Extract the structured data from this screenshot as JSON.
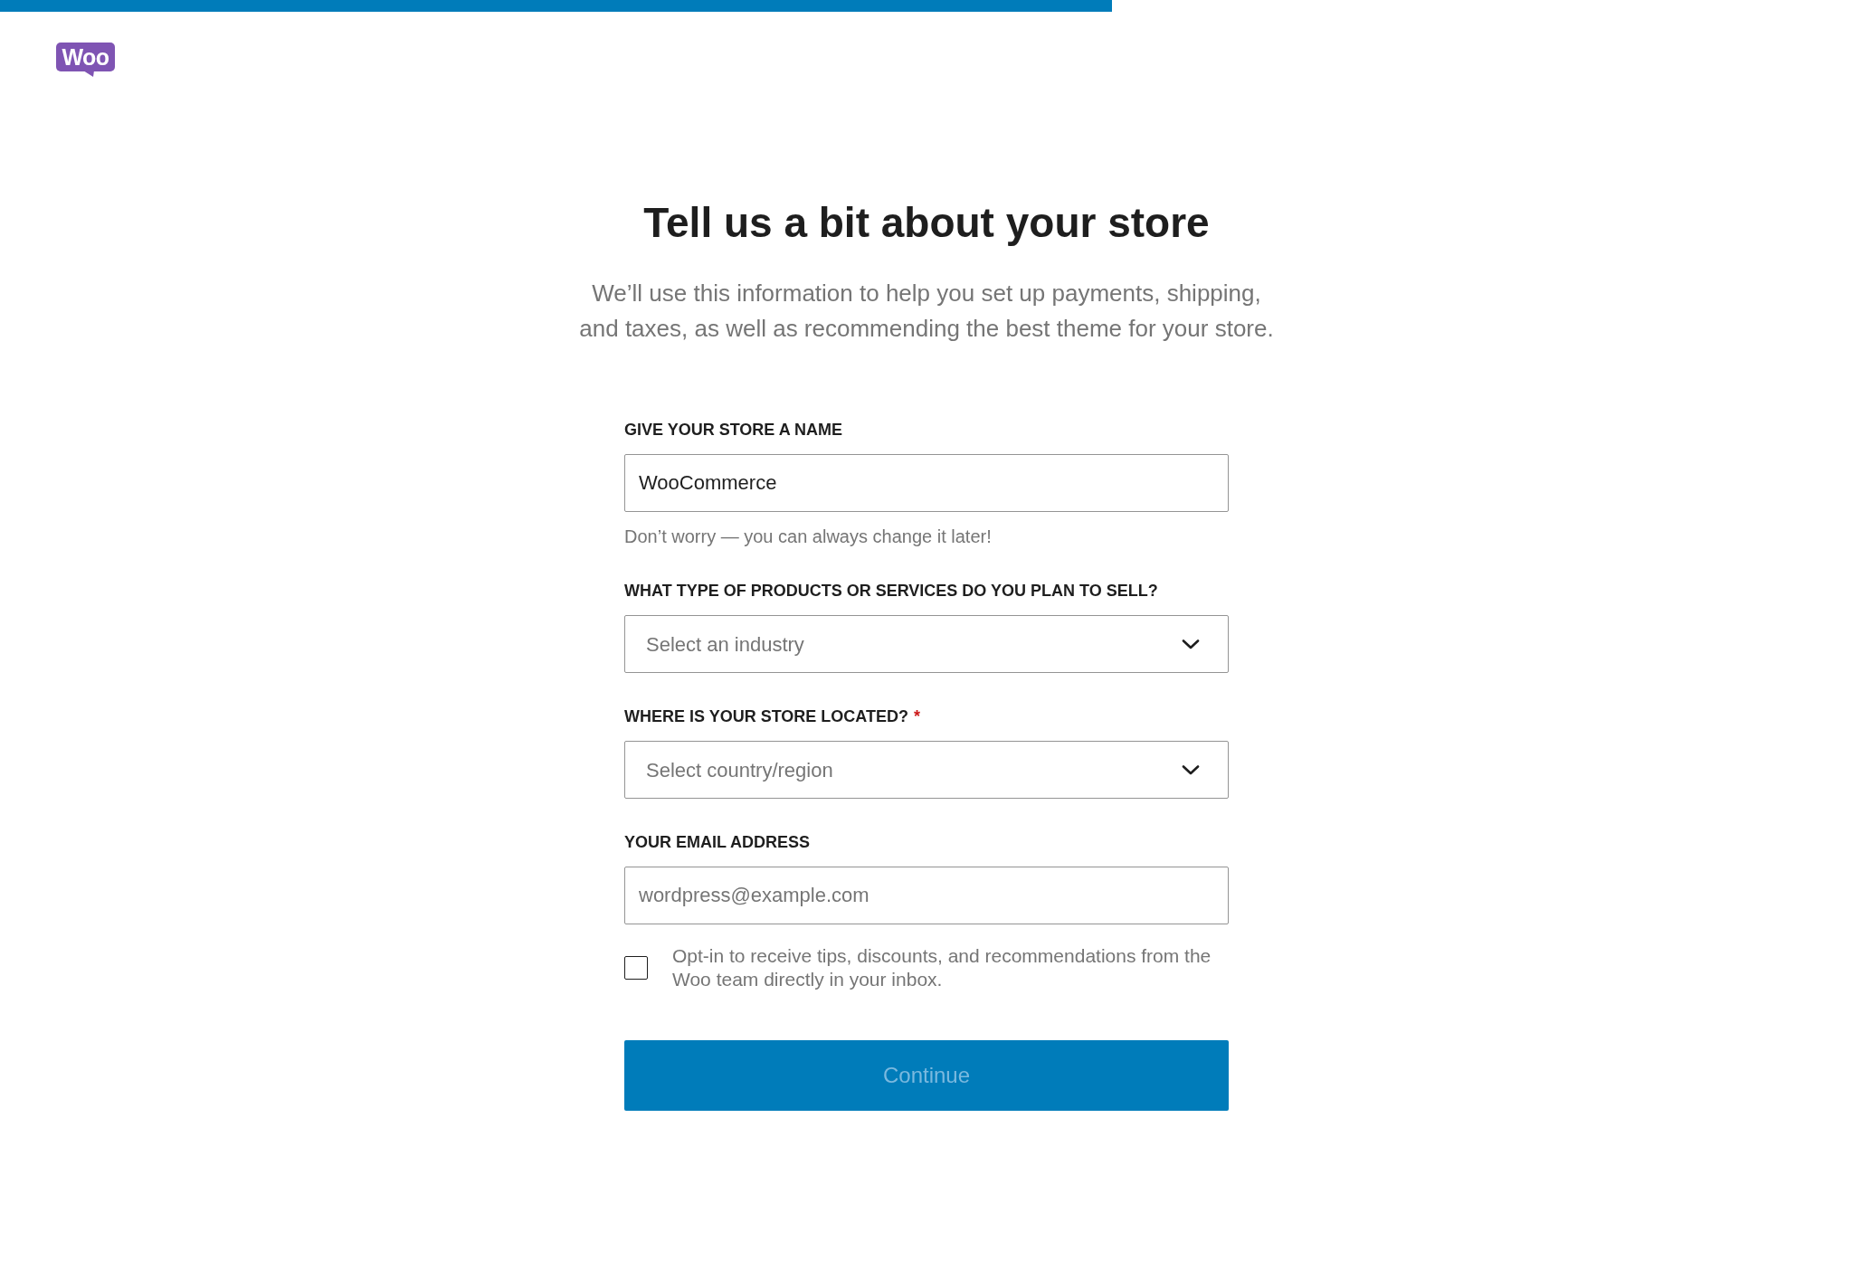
{
  "progress": {
    "level": 0.6
  },
  "logo": {
    "text": "Woo"
  },
  "title": "Tell us a bit about your store",
  "subtitle": "We’ll use this information to help you set up payments, shipping, and taxes, as well as recommending the best theme for your store.",
  "fields": [
    {
      "kind": "text",
      "label": "GIVE YOUR STORE A NAME",
      "value": "WooCommerce",
      "help": "Don’t worry — you can always change it later!"
    },
    {
      "kind": "select",
      "label": "WHAT TYPE OF PRODUCTS OR SERVICES DO YOU PLAN TO SELL?",
      "placeholder": "Select an industry"
    },
    {
      "kind": "select",
      "label": "WHERE IS YOUR STORE LOCATED?",
      "required_mark": "*",
      "placeholder": "Select country/region"
    },
    {
      "kind": "email",
      "label": "YOUR EMAIL ADDRESS",
      "placeholder": "wordpress@example.com"
    }
  ],
  "opt_in": {
    "checked": false,
    "label": "Opt-in to receive tips, discounts, and recommendations from the Woo team directly in your inbox."
  },
  "continue_button": {
    "label": "Continue",
    "disabled": true
  }
}
